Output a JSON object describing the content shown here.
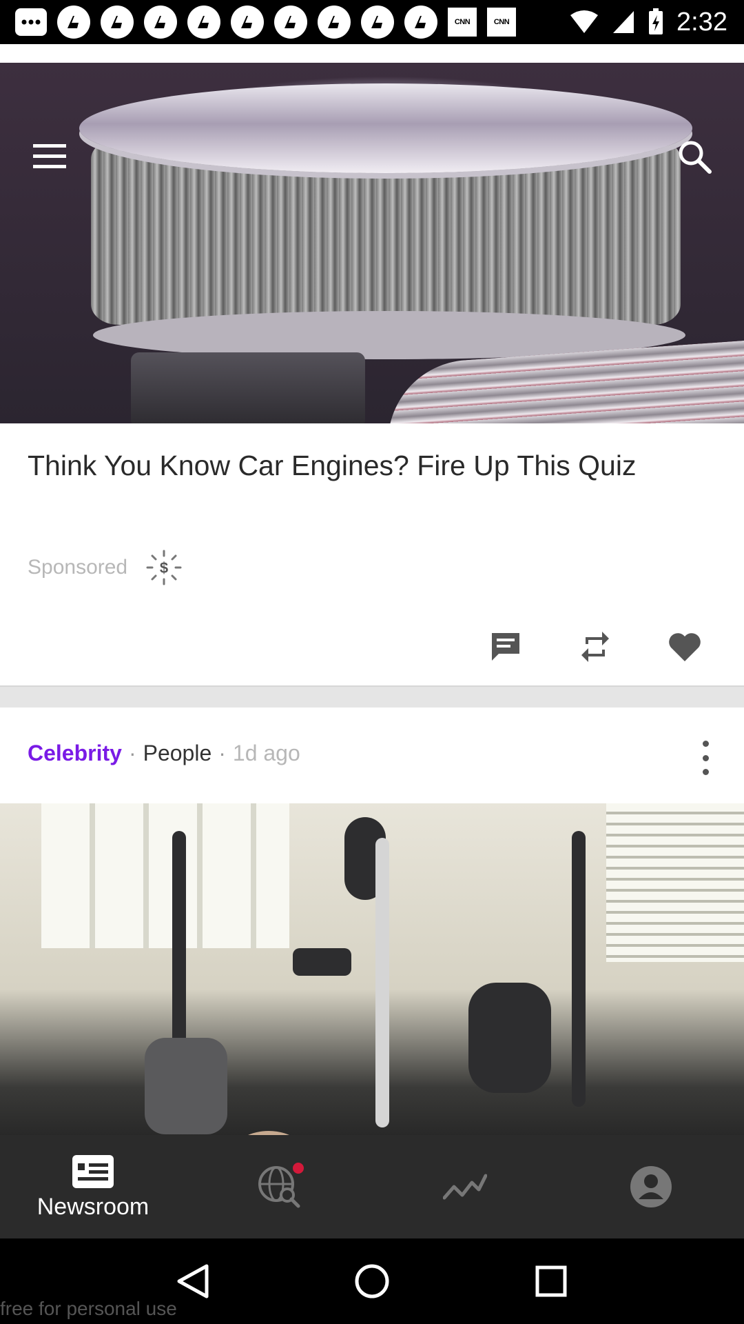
{
  "status_bar": {
    "time": "2:32",
    "notification_icons": [
      "message-icon",
      "app-icon",
      "app-icon",
      "app-icon",
      "app-icon",
      "app-icon",
      "app-icon",
      "app-icon",
      "app-icon",
      "app-icon"
    ],
    "cnn_badges": [
      "CNN",
      "CNN"
    ]
  },
  "header": {
    "menu_icon": "hamburger-menu-icon",
    "search_icon": "search-icon"
  },
  "sponsored_card": {
    "title": "Think You Know Car Engines? Fire Up This Quiz",
    "sponsored_label": "Sponsored",
    "sponsored_icon": "dollar-badge-icon",
    "actions": [
      "comment-icon",
      "repost-icon",
      "heart-icon"
    ]
  },
  "next_card": {
    "category": "Celebrity",
    "separator": "·",
    "source": "People",
    "time": "1d ago"
  },
  "bottom_nav": {
    "items": [
      {
        "label": "Newsroom",
        "icon": "newsroom-icon",
        "active": true
      },
      {
        "label": "",
        "icon": "globe-search-icon",
        "badge": true
      },
      {
        "label": "",
        "icon": "trending-chart-icon"
      },
      {
        "label": "",
        "icon": "profile-icon"
      }
    ]
  },
  "system_nav": {
    "buttons": [
      "back-icon",
      "home-icon",
      "recents-icon"
    ]
  },
  "watermark": "free for personal use",
  "colors": {
    "accent_purple": "#7a1be6",
    "nav_bg": "#2b2b2b",
    "badge_red": "#d3193a"
  }
}
